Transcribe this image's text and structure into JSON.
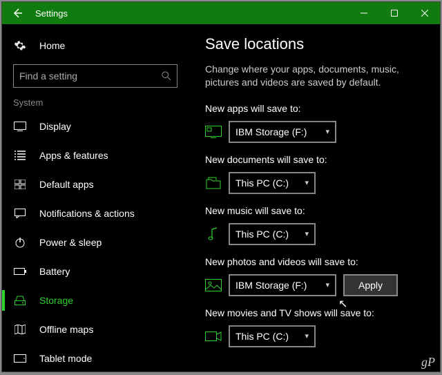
{
  "titlebar": {
    "title": "Settings"
  },
  "sidebar": {
    "home": "Home",
    "search_placeholder": "Find a setting",
    "section": "System",
    "items": [
      {
        "label": "Display"
      },
      {
        "label": "Apps & features"
      },
      {
        "label": "Default apps"
      },
      {
        "label": "Notifications & actions"
      },
      {
        "label": "Power & sleep"
      },
      {
        "label": "Battery"
      },
      {
        "label": "Storage"
      },
      {
        "label": "Offline maps"
      },
      {
        "label": "Tablet mode"
      }
    ]
  },
  "main": {
    "title": "Save locations",
    "description": "Change where your apps, documents, music, pictures and videos are saved by default.",
    "settings": [
      {
        "label": "New apps will save to:",
        "value": "IBM Storage (F:)"
      },
      {
        "label": "New documents will save to:",
        "value": "This PC (C:)"
      },
      {
        "label": "New music will save to:",
        "value": "This PC (C:)"
      },
      {
        "label": "New photos and videos will save to:",
        "value": "IBM Storage (F:)"
      },
      {
        "label": "New movies and TV shows will save to:",
        "value": "This PC (C:)"
      }
    ],
    "apply": "Apply"
  },
  "watermark": "gP"
}
